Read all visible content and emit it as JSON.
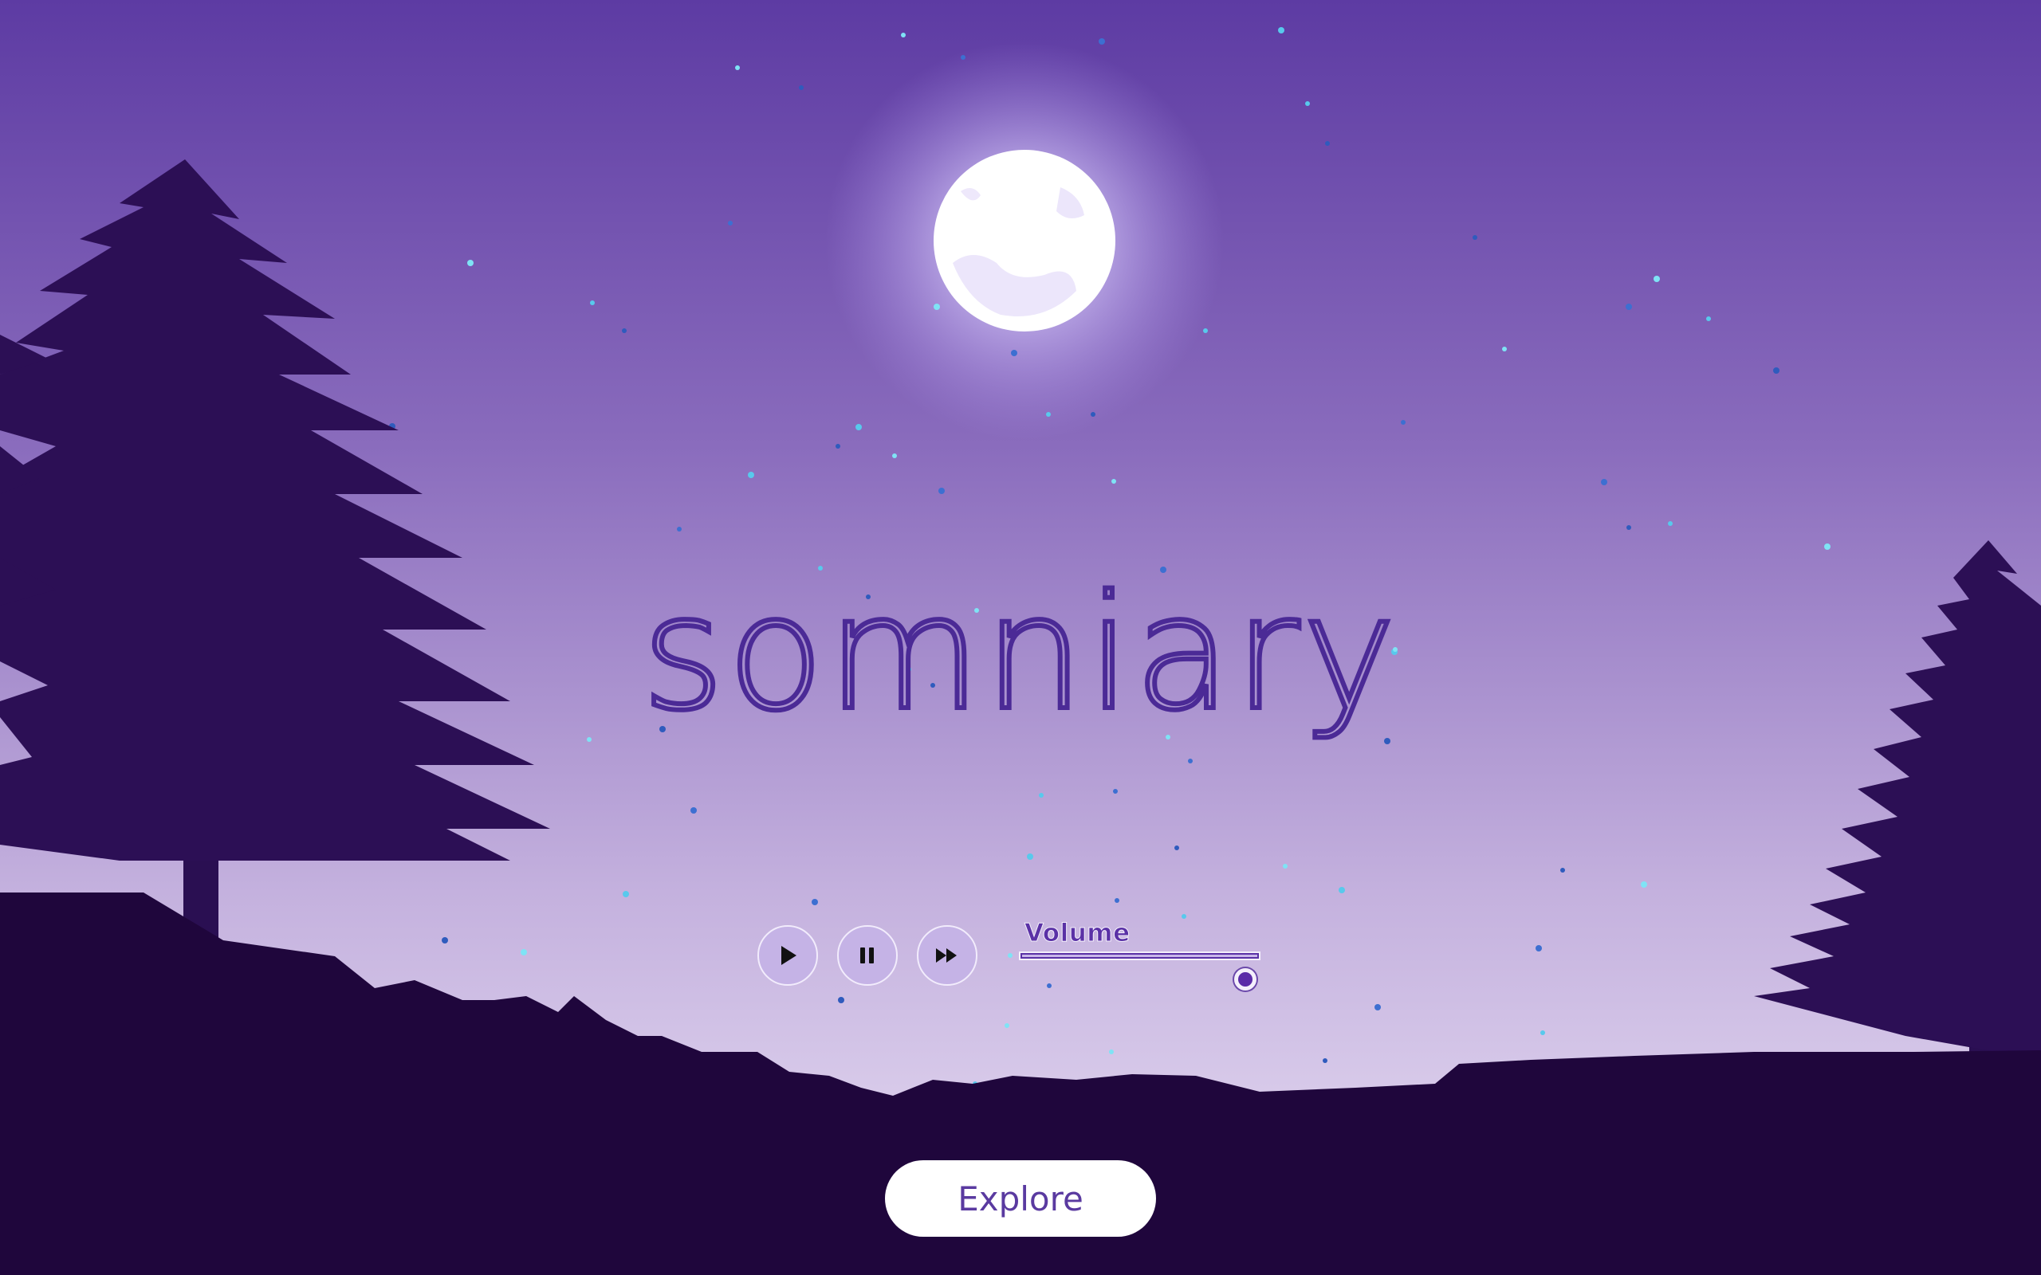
{
  "hero": {
    "title": "somniary"
  },
  "player": {
    "play_icon": "play-icon",
    "pause_icon": "pause-icon",
    "fast_forward_icon": "fast-forward-icon",
    "volume_label": "Volume",
    "volume_level": 0.94
  },
  "cta": {
    "explore_label": "Explore"
  },
  "colors": {
    "sky_top": "#5d3ba3",
    "sky_bottom": "#e6dcf2",
    "silhouette": "#2a0f52",
    "ground": "#1f063c",
    "accent": "#5a31a6"
  }
}
